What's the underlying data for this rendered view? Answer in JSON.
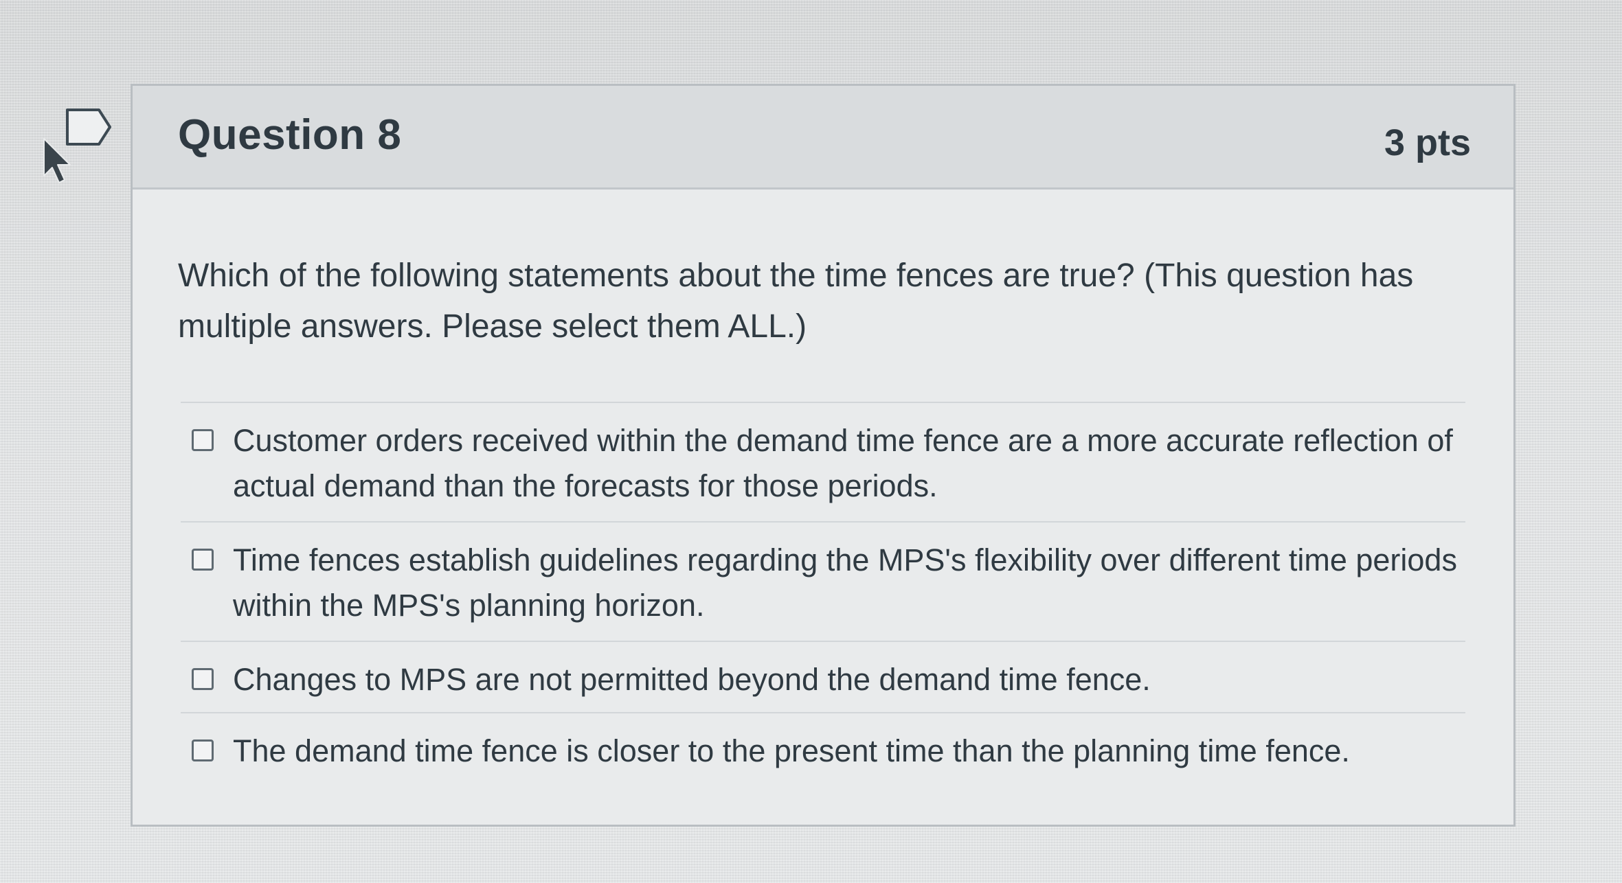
{
  "question": {
    "title": "Question 8",
    "points": "3 pts",
    "prompt": "Which of the following statements about the time fences are true? (This question has multiple answers. Please select them ALL.)",
    "answers": [
      {
        "label": "Customer orders received within the demand time fence are a more accurate reflection of actual demand than the forecasts for those periods.",
        "checked": false
      },
      {
        "label": "Time fences establish guidelines regarding the MPS's flexibility over different time periods within the MPS's planning horizon.",
        "checked": false
      },
      {
        "label": "Changes to MPS are not permitted beyond the demand time fence.",
        "checked": false
      },
      {
        "label": "The demand time fence is closer to the present time than the planning time fence.",
        "checked": false
      }
    ]
  },
  "icons": {
    "cursor": "mouse-pointer-icon",
    "flag": "flag-question-icon"
  },
  "colors": {
    "text": "#2f3a42",
    "header_bg": "#d9dcde",
    "card_bg": "#e9ebec",
    "border": "#b9bec2"
  }
}
